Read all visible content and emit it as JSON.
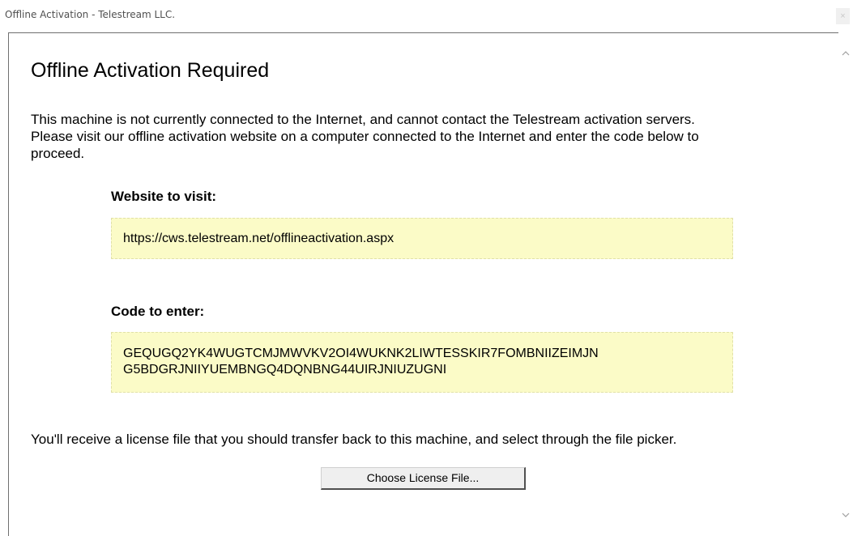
{
  "window": {
    "title": "Offline Activation - Telestream LLC.",
    "close_label": "×"
  },
  "page": {
    "heading": "Offline Activation Required",
    "intro_line1": "This machine is not currently connected to the Internet, and cannot contact the Telestream activation servers.",
    "intro_line2": "Please visit our offline activation website on a computer connected to the Internet and enter the code below to",
    "intro_line3": "proceed.",
    "website_label": "Website to visit:",
    "website_url": "https://cws.telestream.net/offlineactivation.aspx",
    "code_label": "Code to enter:",
    "code_line1": "GEQUGQ2YK4WUGTCMJMWVKV2OI4WUKNK2LIWTESSKIR7FOMBNIIZEIMJN",
    "code_line2": "G5BDGRJNIIYUEMBNGQ4DQNBNG44UIRJNIUZUGNI",
    "footer_text": "You'll receive a license file that you should transfer back to this machine, and select through the file picker.",
    "choose_button_label": "Choose License File..."
  },
  "colors": {
    "highlight_box": "#fbfbc7",
    "highlight_border": "#e0e0a8"
  },
  "icons": {
    "scroll_up": "chevron-up-icon",
    "scroll_down": "chevron-down-icon",
    "close": "close-icon"
  }
}
